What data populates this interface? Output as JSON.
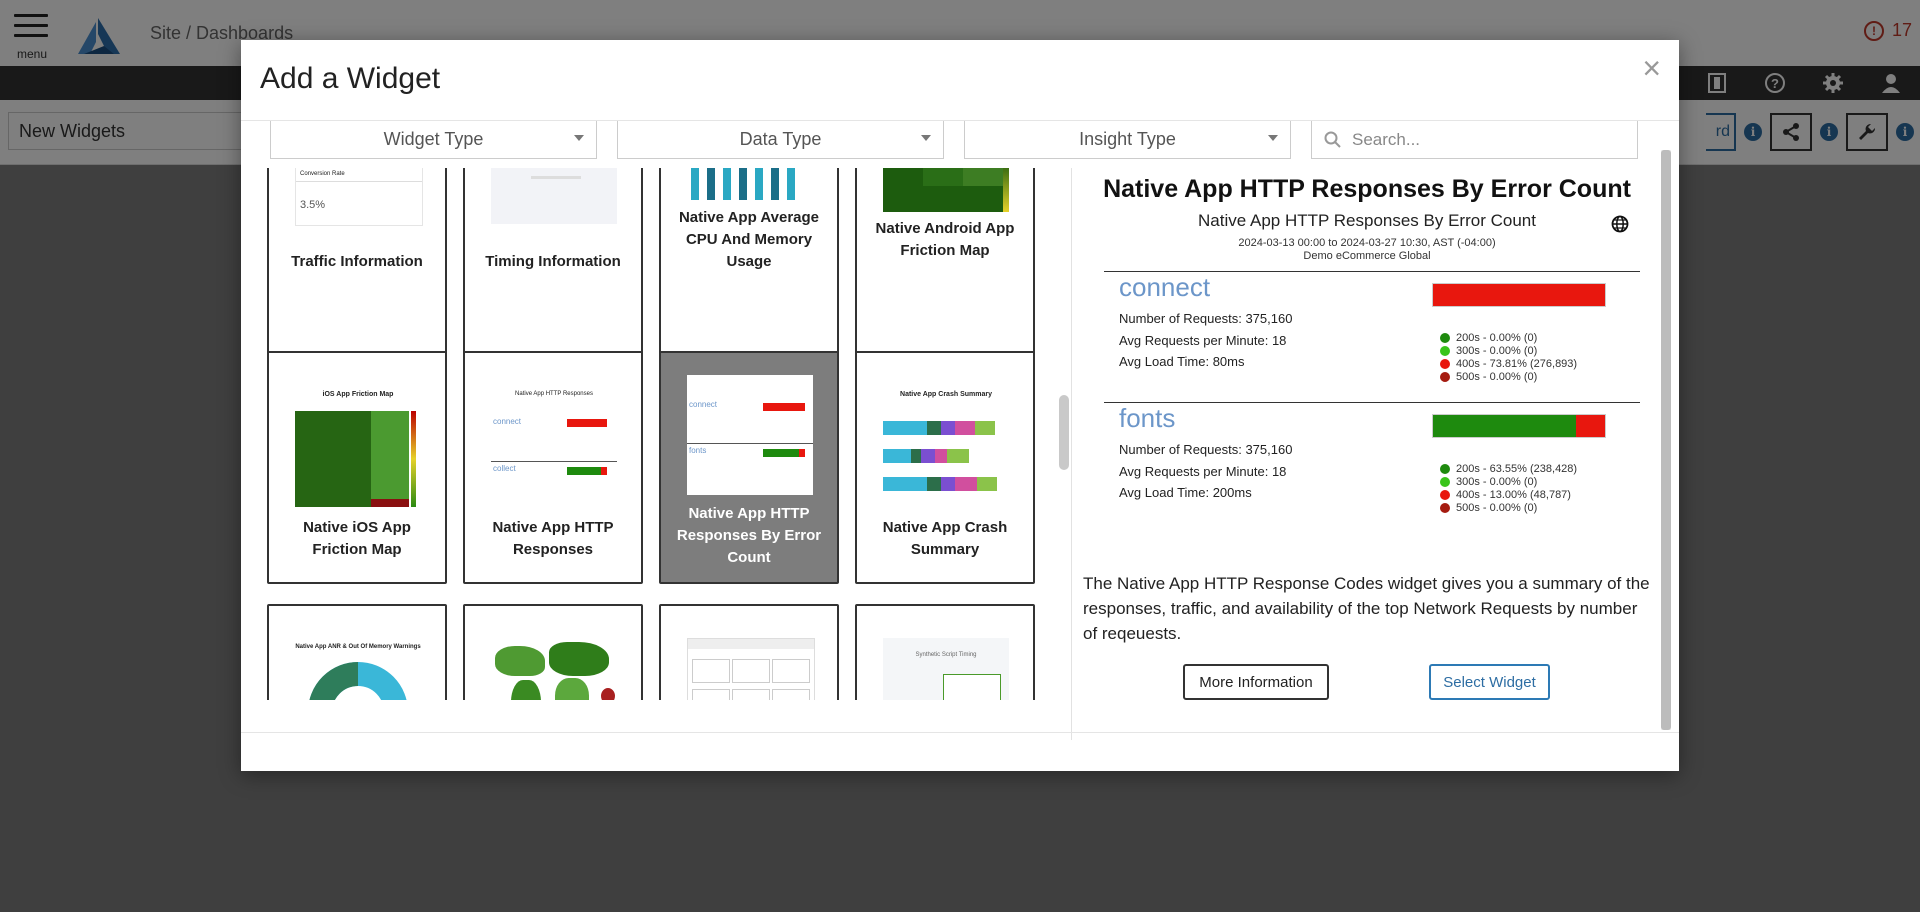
{
  "app": {
    "menu_label": "menu",
    "breadcrumb": "Site / Dashboards",
    "alert_count": "17",
    "dashboard_name": "New Widgets",
    "partial_button_text": "rd"
  },
  "modal": {
    "title": "Add a Widget",
    "close": "×",
    "filters": {
      "widget_type": "Widget Type",
      "data_type": "Data Type",
      "insight_type": "Insight Type",
      "search_placeholder": "Search..."
    },
    "cards": [
      {
        "label": "Traffic Information",
        "mini_text": "Conversion Rate",
        "mini_value": "3.5%"
      },
      {
        "label": "Timing Information"
      },
      {
        "label": "Native App Average CPU And Memory Usage"
      },
      {
        "label": "Native Android App Friction Map"
      },
      {
        "label": "Native iOS App Friction Map",
        "mini_title": "iOS App Friction Map"
      },
      {
        "label": "Native App HTTP Responses",
        "mini_title": "Native App HTTP Responses",
        "mini_a": "connect",
        "mini_b": "collect"
      },
      {
        "label": "Native App HTTP Responses By Error Count",
        "selected": true,
        "mini_a": "connect",
        "mini_b": "fonts"
      },
      {
        "label": "Native App Crash Summary",
        "mini_title": "Native App Crash Summary"
      },
      {
        "label": "",
        "mini_title": "Native App ANR & Out Of Memory Warnings"
      },
      {
        "label": ""
      },
      {
        "label": ""
      },
      {
        "label": "",
        "mini_title": "Synthetic Script Timing"
      }
    ],
    "preview": {
      "title": "Native App HTTP Responses By Error Count",
      "subtitle": "Native App HTTP Responses By Error Count",
      "date_range": "2024-03-13 00:00 to 2024-03-27 10:30, AST (-04:00)",
      "site": "Demo eCommerce Global",
      "sections": [
        {
          "name": "connect",
          "requests": "Number of Requests: 375,160",
          "per_minute": "Avg Requests per Minute: 18",
          "load_time": "Avg Load Time: 80ms",
          "bar": [
            {
              "color": "#e8170e",
              "fraction": 1.0
            }
          ],
          "legend": [
            {
              "text": "200s - 0.00% (0)",
              "color": "#1e8a0e"
            },
            {
              "text": "300s - 0.00% (0)",
              "color": "#39c41a"
            },
            {
              "text": "400s - 73.81% (276,893)",
              "color": "#e8170e"
            },
            {
              "text": "500s - 0.00% (0)",
              "color": "#a51b10"
            }
          ]
        },
        {
          "name": "fonts",
          "requests": "Number of Requests: 375,160",
          "per_minute": "Avg Requests per Minute: 18",
          "load_time": "Avg Load Time: 200ms",
          "bar": [
            {
              "color": "#1e8a0e",
              "fraction": 0.83
            },
            {
              "color": "#e8170e",
              "fraction": 0.17
            }
          ],
          "legend": [
            {
              "text": "200s - 63.55% (238,428)",
              "color": "#1e8a0e"
            },
            {
              "text": "300s - 0.00% (0)",
              "color": "#39c41a"
            },
            {
              "text": "400s - 13.00% (48,787)",
              "color": "#e8170e"
            },
            {
              "text": "500s - 0.00% (0)",
              "color": "#a51b10"
            }
          ]
        }
      ],
      "description": "The Native App HTTP Response Codes widget gives you a summary of the responses, traffic, and availability of the top Network Requests by number of reqeuests.",
      "more_info_label": "More Information",
      "select_label": "Select Widget"
    }
  }
}
